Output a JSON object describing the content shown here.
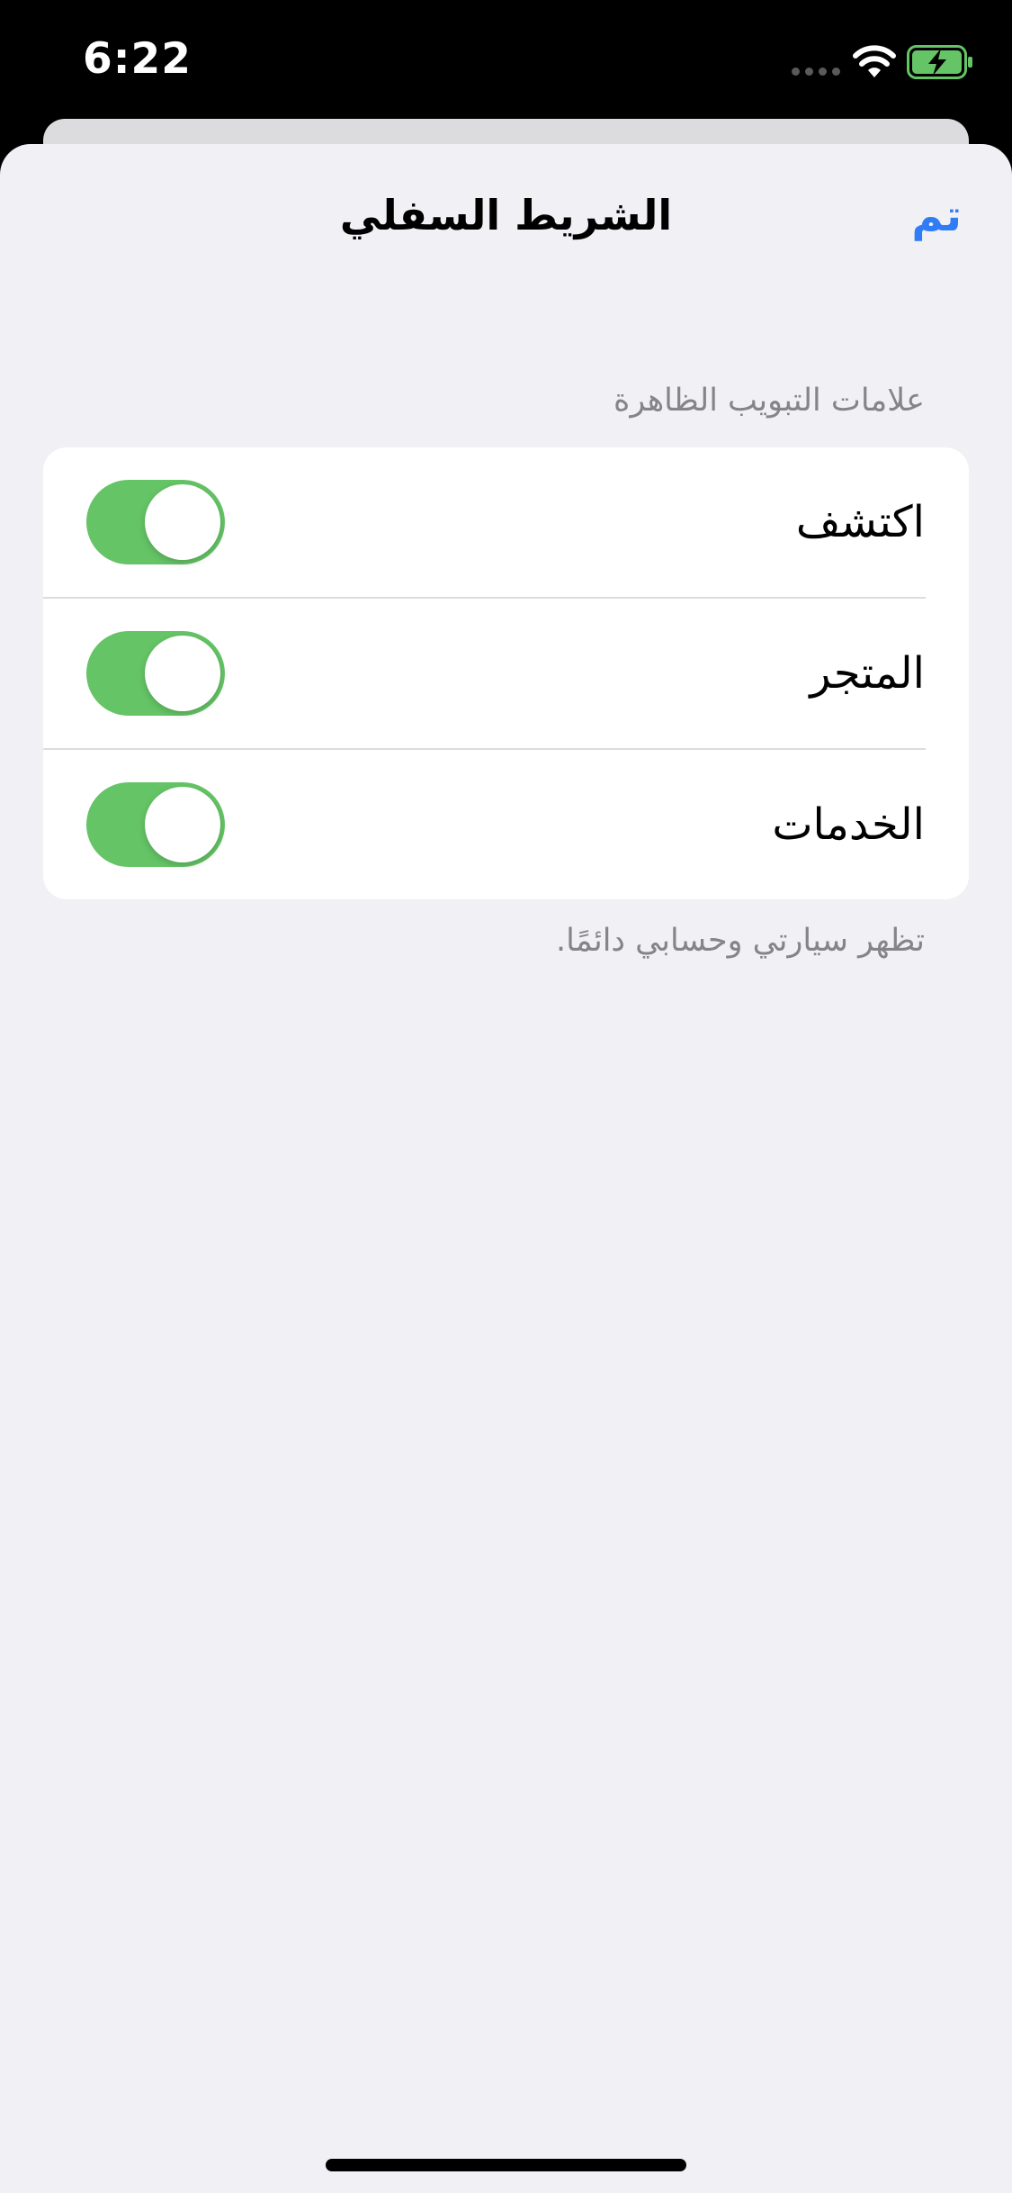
{
  "status_bar": {
    "time": "6:22",
    "signal_icon": "cellular-signal-icon",
    "wifi_icon": "wifi-icon",
    "battery_icon": "battery-charging-icon",
    "battery_color": "#65c466"
  },
  "nav": {
    "title": "الشريط السفلي",
    "done_label": "تم",
    "accent_color": "#2f7cf6"
  },
  "section": {
    "header": "علامات التبويب الظاهرة",
    "footer": "تظهر سيارتي وحسابي دائمًا.",
    "items": [
      {
        "label": "اكتشف",
        "enabled": true
      },
      {
        "label": "المتجر",
        "enabled": true
      },
      {
        "label": "الخدمات",
        "enabled": true
      }
    ]
  },
  "colors": {
    "toggle_on": "#65c466",
    "background": "#f0f0f5"
  }
}
